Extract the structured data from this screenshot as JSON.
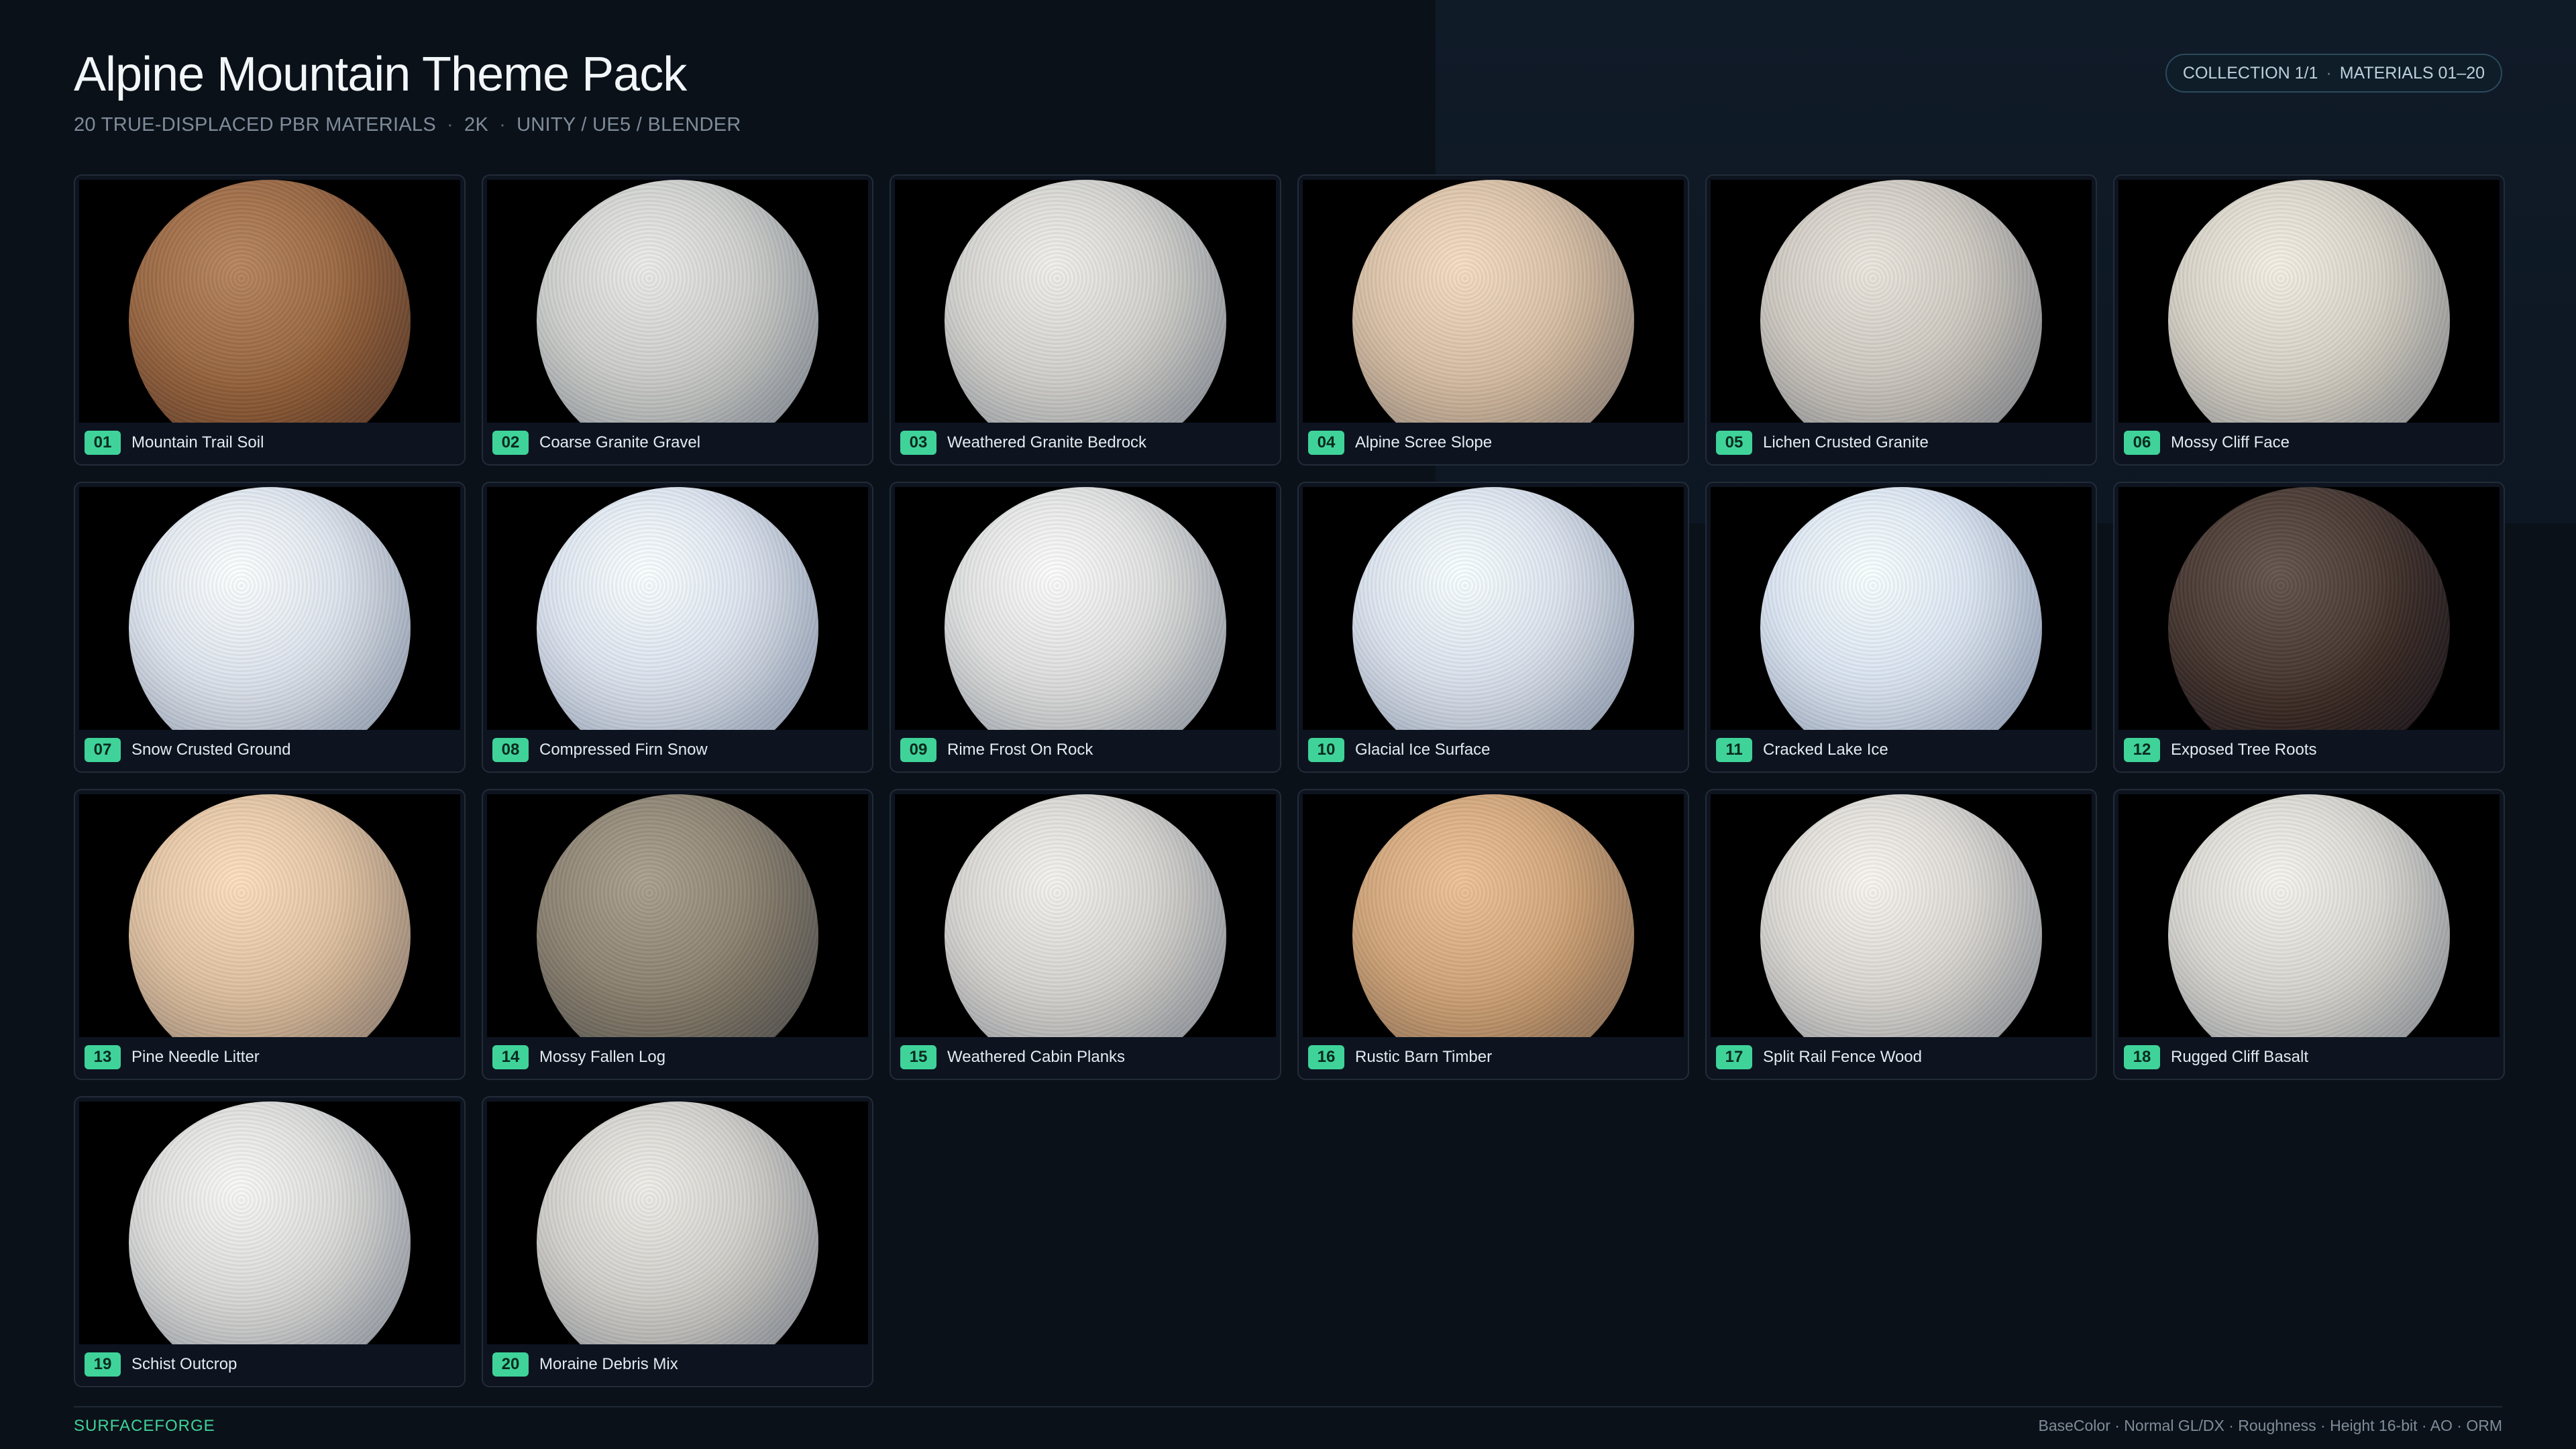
{
  "header": {
    "title": "Alpine Mountain Theme Pack",
    "subtitle_parts": [
      "20 TRUE-DISPLACED PBR MATERIALS",
      "2K",
      "UNITY / UE5 / BLENDER"
    ],
    "collection_label": "COLLECTION 1/1",
    "materials_range": "MATERIALS 01–20"
  },
  "materials": [
    {
      "num": "01",
      "name": "Mountain Trail Soil",
      "tone": "#9c6a45"
    },
    {
      "num": "02",
      "name": "Coarse Granite Gravel",
      "tone": "#cfd0cd"
    },
    {
      "num": "03",
      "name": "Weathered Granite Bedrock",
      "tone": "#d4d3cf"
    },
    {
      "num": "04",
      "name": "Alpine Scree Slope",
      "tone": "#d9c1a7"
    },
    {
      "num": "05",
      "name": "Lichen Crusted Granite",
      "tone": "#cfcac2"
    },
    {
      "num": "06",
      "name": "Mossy Cliff Face",
      "tone": "#d8d3c8"
    },
    {
      "num": "07",
      "name": "Snow Crusted Ground",
      "tone": "#dfe5ee"
    },
    {
      "num": "08",
      "name": "Compressed Firn Snow",
      "tone": "#dde4ef"
    },
    {
      "num": "09",
      "name": "Rime Frost On Rock",
      "tone": "#dfe0df"
    },
    {
      "num": "10",
      "name": "Glacial Ice Surface",
      "tone": "#dce3ee"
    },
    {
      "num": "11",
      "name": "Cracked Lake Ice",
      "tone": "#dce5f2"
    },
    {
      "num": "12",
      "name": "Exposed Tree Roots",
      "tone": "#4a3a33"
    },
    {
      "num": "13",
      "name": "Pine Needle Litter",
      "tone": "#e1c3a3"
    },
    {
      "num": "14",
      "name": "Mossy Fallen Log",
      "tone": "#8f8574"
    },
    {
      "num": "15",
      "name": "Weathered Cabin Planks",
      "tone": "#d8d6d2"
    },
    {
      "num": "16",
      "name": "Rustic Barn Timber",
      "tone": "#d2a77c"
    },
    {
      "num": "17",
      "name": "Split Rail Fence Wood",
      "tone": "#dcd9d4"
    },
    {
      "num": "18",
      "name": "Rugged Cliff Basalt",
      "tone": "#dad8d2"
    },
    {
      "num": "19",
      "name": "Schist Outcrop",
      "tone": "#dcdcda"
    },
    {
      "num": "20",
      "name": "Moraine Debris Mix",
      "tone": "#d3d1cc"
    }
  ],
  "footer": {
    "brand": "SURFACEFORGE",
    "maps": "BaseColor · Normal GL/DX · Roughness · Height 16-bit · AO · ORM"
  },
  "colors": {
    "accent": "#3fd39a",
    "background": "#0b1119",
    "card_border": "#222c38"
  }
}
